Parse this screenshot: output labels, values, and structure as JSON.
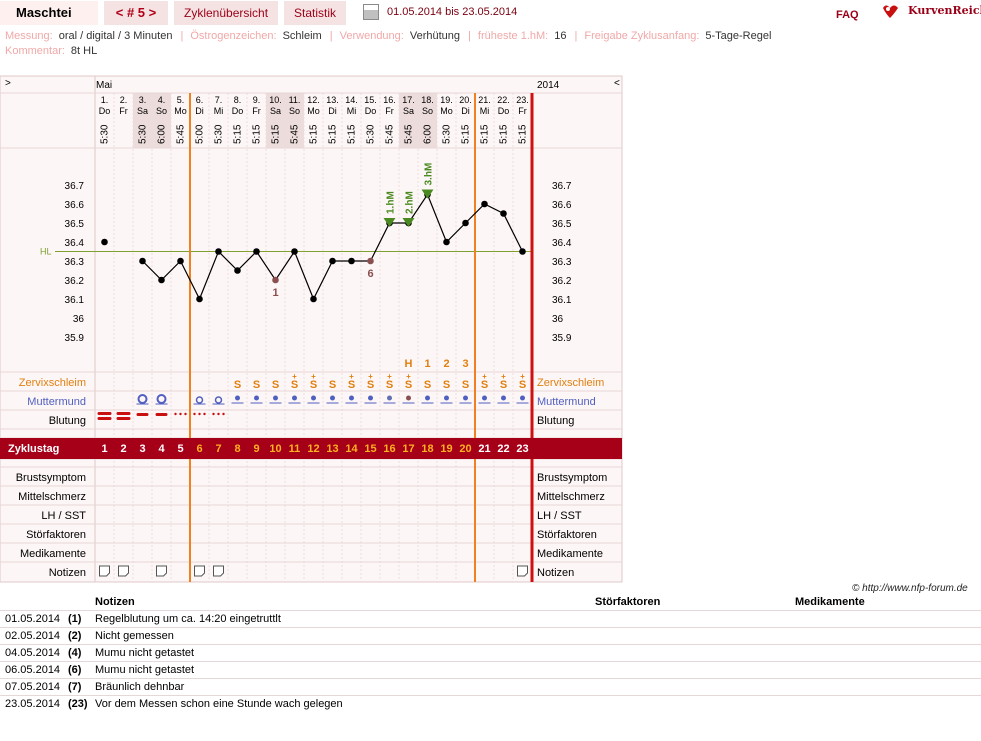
{
  "header": {
    "name": "Maschtei",
    "cycle_nav": "< # 5 >",
    "tabs": [
      "Zyklenübersicht",
      "Statistik"
    ],
    "date_range": "01.05.2014 bis 23.05.2014",
    "faq": "FAQ",
    "logo": "KurvenReich"
  },
  "meta": {
    "line1": [
      {
        "k": "Messung:",
        "v": "oral / digital / 3 Minuten"
      },
      {
        "k": "Östrogenzeichen:",
        "v": "Schleim"
      },
      {
        "k": "Verwendung:",
        "v": "Verhütung"
      },
      {
        "k": "früheste 1.hM:",
        "v": "16"
      },
      {
        "k": "Freigabe Zyklusanfang:",
        "v": "5-Tage-Regel"
      }
    ],
    "line2": [
      {
        "k": "Kommentar:",
        "v": "8t HL"
      }
    ]
  },
  "chart": {
    "prev": ">",
    "next": "<",
    "month": "Mai",
    "year": "2014",
    "days": [
      {
        "d": "1.",
        "wd": "Do",
        "t": "5:30",
        "we": false
      },
      {
        "d": "2.",
        "wd": "Fr",
        "t": "",
        "we": false
      },
      {
        "d": "3.",
        "wd": "Sa",
        "t": "5:30",
        "we": true
      },
      {
        "d": "4.",
        "wd": "So",
        "t": "6:00",
        "we": true
      },
      {
        "d": "5.",
        "wd": "Mo",
        "t": "5:45",
        "we": false
      },
      {
        "d": "6.",
        "wd": "Di",
        "t": "5:00",
        "we": false
      },
      {
        "d": "7.",
        "wd": "Mi",
        "t": "5:30",
        "we": false
      },
      {
        "d": "8.",
        "wd": "Do",
        "t": "5:15",
        "we": false
      },
      {
        "d": "9.",
        "wd": "Fr",
        "t": "5:15",
        "we": false
      },
      {
        "d": "10.",
        "wd": "Sa",
        "t": "5:15",
        "we": true
      },
      {
        "d": "11.",
        "wd": "So",
        "t": "5:45",
        "we": true
      },
      {
        "d": "12.",
        "wd": "Mo",
        "t": "5:15",
        "we": false
      },
      {
        "d": "13.",
        "wd": "Di",
        "t": "5:15",
        "we": false
      },
      {
        "d": "14.",
        "wd": "Mi",
        "t": "5:15",
        "we": false
      },
      {
        "d": "15.",
        "wd": "Do",
        "t": "5:30",
        "we": false
      },
      {
        "d": "16.",
        "wd": "Fr",
        "t": "5:45",
        "we": false
      },
      {
        "d": "17.",
        "wd": "Sa",
        "t": "5:45",
        "we": true
      },
      {
        "d": "18.",
        "wd": "So",
        "t": "6:00",
        "we": true
      },
      {
        "d": "19.",
        "wd": "Mo",
        "t": "5:30",
        "we": false
      },
      {
        "d": "20.",
        "wd": "Di",
        "t": "5:15",
        "we": false
      },
      {
        "d": "21.",
        "wd": "Mi",
        "t": "5:15",
        "we": false
      },
      {
        "d": "22.",
        "wd": "Do",
        "t": "5:15",
        "we": false
      },
      {
        "d": "23.",
        "wd": "Fr",
        "t": "5:15",
        "we": false
      }
    ],
    "temp_ticks": [
      "36.7",
      "36.6",
      "36.5",
      "36.4",
      "36.3",
      "36.2",
      "36.1",
      "36",
      "35.9"
    ],
    "hl_label": "HL",
    "hl_value": 36.35,
    "temps": [
      36.4,
      null,
      36.3,
      36.2,
      36.3,
      36.1,
      36.35,
      36.25,
      36.35,
      36.2,
      36.35,
      36.1,
      36.3,
      36.3,
      36.3,
      36.5,
      36.5,
      36.65,
      36.4,
      36.5,
      36.6,
      36.55,
      36.35
    ],
    "excluded_temps": [
      10,
      15
    ],
    "point_notes": [
      {
        "day": 10,
        "text": "1"
      },
      {
        "day": 15,
        "text": "6"
      }
    ],
    "hm_markers": [
      {
        "day": 16,
        "text": "1.hM"
      },
      {
        "day": 17,
        "text": "2.hM"
      },
      {
        "day": 18,
        "text": "3.hM"
      }
    ],
    "mucus_peak": [
      {
        "day": 17,
        "text": "H"
      },
      {
        "day": 18,
        "text": "1"
      },
      {
        "day": 19,
        "text": "2"
      },
      {
        "day": 20,
        "text": "3"
      }
    ],
    "cervical_mucus": [
      "",
      "",
      "",
      "",
      "",
      "",
      "",
      "S",
      "S",
      "S",
      "S+",
      "S+",
      "S",
      "S+",
      "S+",
      "S+",
      "S+",
      "S",
      "S",
      "S",
      "S+",
      "S+",
      "S+"
    ],
    "cervix": [
      "",
      "",
      "O",
      "O",
      "",
      "o",
      "o",
      "",
      "",
      "",
      "",
      "",
      "",
      "",
      "",
      "",
      "",
      "",
      "",
      "",
      "",
      "",
      ""
    ],
    "bleeding": [
      "heavy",
      "heavy",
      "medium",
      "medium",
      "spot",
      "spot",
      "spot",
      "",
      "",
      "",
      "",
      "",
      "",
      "",
      "",
      "",
      "",
      "",
      "",
      "",
      "",
      "",
      ""
    ],
    "notes_icons": [
      1,
      2,
      4,
      6,
      7,
      23
    ],
    "vlines": [
      {
        "after": 5,
        "color": "#f08020"
      },
      {
        "after": 20,
        "color": "#f08020"
      },
      {
        "after": 23,
        "color": "#d01010"
      }
    ],
    "rows": {
      "zervix": "Zervixschleim",
      "muttermund": "Muttermund",
      "blutung": "Blutung",
      "zyklustag": "Zyklustag",
      "brust": "Brustsymptom",
      "mittel": "Mittelschmerz",
      "lh": "LH / SST",
      "stoer": "Störfaktoren",
      "medi": "Medikamente",
      "notizen": "Notizen"
    },
    "colors": {
      "accent": "#9a0018",
      "orange": "#e08010",
      "purple": "#5060c0",
      "line": "#000000",
      "hl": "#80a030",
      "triangle": "#4a8a20"
    }
  },
  "copyright": "© http://www.nfp-forum.de",
  "notes_table": {
    "headers": [
      "Notizen",
      "Störfaktoren",
      "Medikamente"
    ],
    "rows": [
      {
        "date": "01.05.2014",
        "day": "(1)",
        "note": "Regelblutung um ca. 14:20 eingetruttlt"
      },
      {
        "date": "02.05.2014",
        "day": "(2)",
        "note": "Nicht gemessen"
      },
      {
        "date": "04.05.2014",
        "day": "(4)",
        "note": "Mumu nicht getastet"
      },
      {
        "date": "06.05.2014",
        "day": "(6)",
        "note": "Mumu nicht getastet"
      },
      {
        "date": "07.05.2014",
        "day": "(7)",
        "note": "Bräunlich dehnbar"
      },
      {
        "date": "23.05.2014",
        "day": "(23)",
        "note": "Vor dem Messen schon eine Stunde wach gelegen"
      }
    ]
  }
}
